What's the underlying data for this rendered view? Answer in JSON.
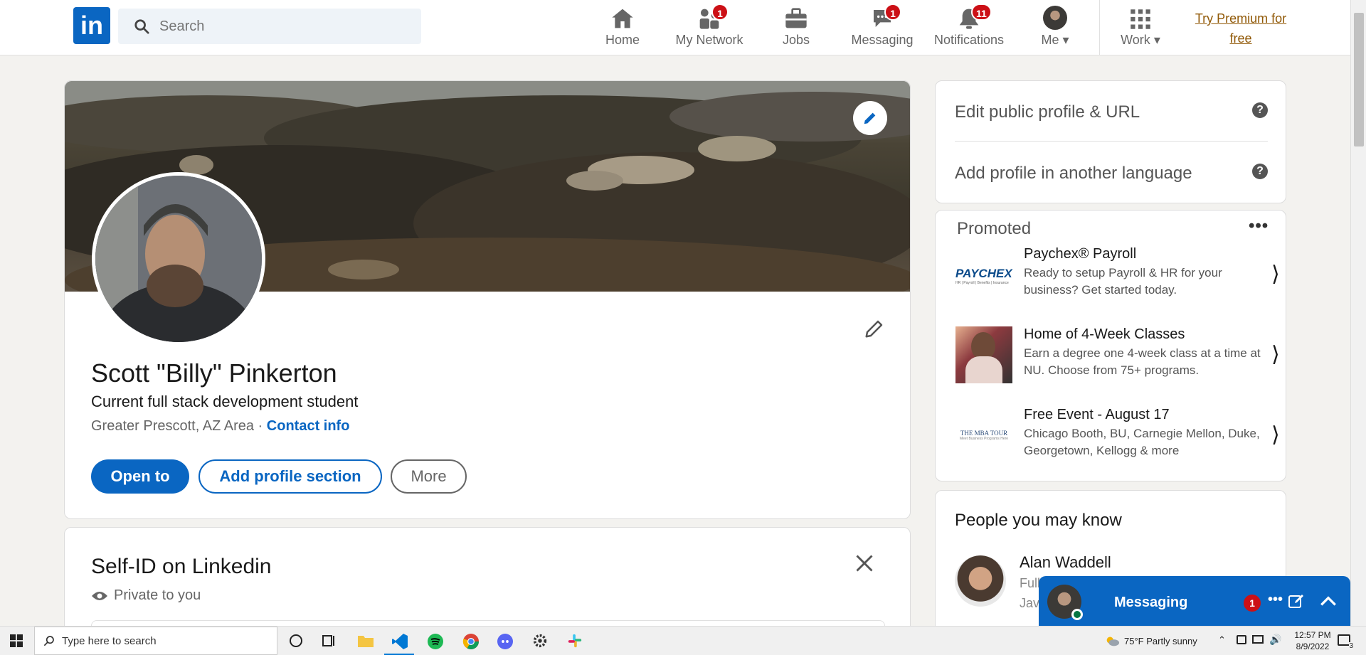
{
  "nav": {
    "logo": "in",
    "search_placeholder": "Search",
    "items": [
      {
        "label": "Home",
        "badge": ""
      },
      {
        "label": "My Network",
        "badge": "1"
      },
      {
        "label": "Jobs",
        "badge": ""
      },
      {
        "label": "Messaging",
        "badge": "1"
      },
      {
        "label": "Notifications",
        "badge": "11"
      },
      {
        "label": "Me",
        "badge": ""
      },
      {
        "label": "Work",
        "badge": ""
      }
    ],
    "premium_line1": "Try Premium for",
    "premium_line2": "free"
  },
  "profile": {
    "name": "Scott \"Billy\" Pinkerton",
    "headline": "Current full stack development student",
    "location": "Greater Prescott, AZ Area",
    "separator": "·",
    "contact_link": "Contact info",
    "buttons": {
      "open_to": "Open to",
      "add_section": "Add profile section",
      "more": "More"
    }
  },
  "selfid": {
    "title": "Self-ID on Linkedin",
    "visibility": "Private to you"
  },
  "sidebar": {
    "edit_public_profile": "Edit public profile & URL",
    "add_language": "Add profile in another language",
    "promoted_title": "Promoted",
    "ads": [
      {
        "brand": "PAYCHEX",
        "brand_sub": "HR | Payroll | Benefits | Insurance",
        "title": "Paychex® Payroll",
        "desc": "Ready to setup Payroll & HR for your business? Get started today."
      },
      {
        "brand": "",
        "title": "Home of 4-Week Classes",
        "desc": "Earn a degree one 4-week class at a time at NU. Choose from 75+ programs."
      },
      {
        "brand": "THE MBA TOUR",
        "brand_sub": "Meet Business Programs Here",
        "title": "Free Event - August 17",
        "desc": "Chicago Booth, BU, Carnegie Mellon, Duke, Georgetown, Kellogg & more"
      }
    ],
    "pymk_title": "People you may know",
    "pymk_person_name": "Alan Waddell",
    "pymk_person_frag1": "Full",
    "pymk_person_frag2": "Java"
  },
  "messaging": {
    "label": "Messaging",
    "badge": "1"
  },
  "taskbar": {
    "search_placeholder": "Type here to search",
    "weather": "75°F  Partly sunny",
    "time": "12:57 PM",
    "date": "8/9/2022",
    "notification_count": "3"
  },
  "colors": {
    "brand": "#0a66c2",
    "badge": "#cc1016",
    "premium": "#915907",
    "background": "#f3f2ef"
  }
}
